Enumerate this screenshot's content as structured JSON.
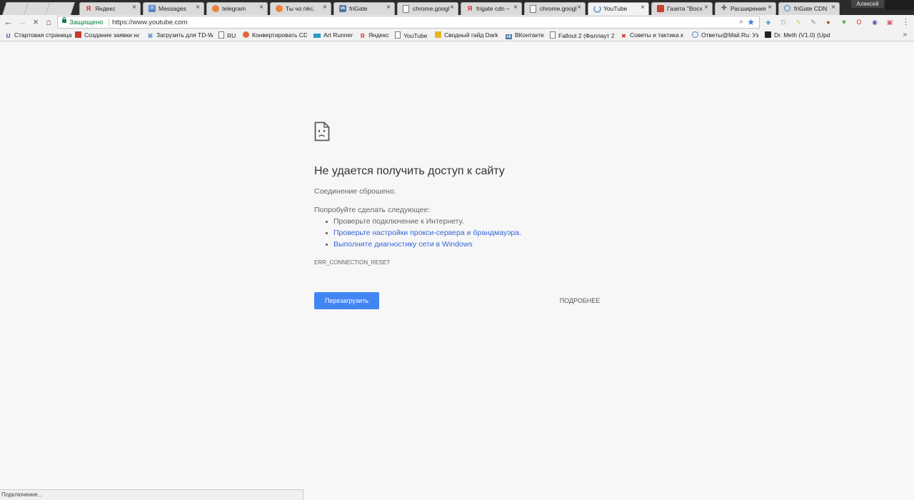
{
  "window": {
    "profile_name": "Алексей"
  },
  "tabs": [
    {
      "title": "Яндекс",
      "icon": "yandex-icon",
      "active": false
    },
    {
      "title": "Messages",
      "icon": "messages-icon",
      "active": false
    },
    {
      "title": "telegram",
      "icon": "firefox-icon",
      "active": false
    },
    {
      "title": "Ты чо пёс.",
      "icon": "firefox-icon",
      "active": false
    },
    {
      "title": "friGate",
      "icon": "vk-icon",
      "active": false
    },
    {
      "title": "chrome.googl",
      "icon": "page-icon",
      "active": false
    },
    {
      "title": "frigate cdn –",
      "icon": "yandex-icon",
      "active": false
    },
    {
      "title": "chrome.googl",
      "icon": "page-icon",
      "active": false
    },
    {
      "title": "YouTube",
      "icon": "loading-spinner-icon",
      "active": true
    },
    {
      "title": "Газета \"Восх",
      "icon": "news-icon",
      "active": false
    },
    {
      "title": "Расширения",
      "icon": "puzzle-icon",
      "active": false
    },
    {
      "title": "friGate CDN",
      "icon": "globe-icon",
      "active": false
    }
  ],
  "tab_close_glyph": "×",
  "toolbar": {
    "security_label": "Защищено",
    "url": "https://www.youtube.com",
    "menu_glyph": "⋮"
  },
  "bookmarks": [
    {
      "label": "Стартовая страница",
      "icon": "u-icon"
    },
    {
      "label": "Создание заявки на",
      "icon": "red-square-icon"
    },
    {
      "label": "Загрузить для TD-W",
      "icon": "playstation-icon"
    },
    {
      "label": "RU",
      "icon": "page-icon"
    },
    {
      "label": "Конвертировать CD",
      "icon": "converter-icon"
    },
    {
      "label": "Art Runner",
      "icon": "art-runner-icon"
    },
    {
      "label": "Яндекс",
      "icon": "yandex-icon"
    },
    {
      "label": "YouTube",
      "icon": "page-icon"
    },
    {
      "label": "Сводный гайд Dark S",
      "icon": "dark-souls-icon"
    },
    {
      "label": "ВКонтакте",
      "icon": "vk-icon"
    },
    {
      "label": "Fallout 2 (Фаллаут 2)",
      "icon": "page-icon"
    },
    {
      "label": "Советы и тактика к",
      "icon": "tips-icon"
    },
    {
      "label": "Ответы@Mail.Ru: Уз",
      "icon": "answers-icon"
    },
    {
      "label": "Dr. Meth (V1.0) (Upd",
      "icon": "dr-meth-icon"
    }
  ],
  "bookmarks_more_glyph": "»",
  "error": {
    "title": "Не удается получить доступ к сайту",
    "description": "Соединение сброшено.",
    "try_label": "Попробуйте сделать следующее:",
    "suggestions": [
      {
        "text": "Проверьте подключение к Интернету.",
        "link": false
      },
      {
        "text": "Проверьте настройки прокси-сервера и брандмауэра.",
        "link": true
      },
      {
        "text": "Выполните диагностику сети в Windows",
        "link": true
      }
    ],
    "code": "ERR_CONNECTION_RESET",
    "reload_label": "Перезагрузить",
    "details_label": "ПОДРОБНЕЕ"
  },
  "status": {
    "text": "Подключение..."
  },
  "colors": {
    "accent_blue": "#4285f4",
    "link_blue": "#3367d6",
    "secure_green": "#0b8043",
    "page_bg": "#f7f7f7"
  }
}
